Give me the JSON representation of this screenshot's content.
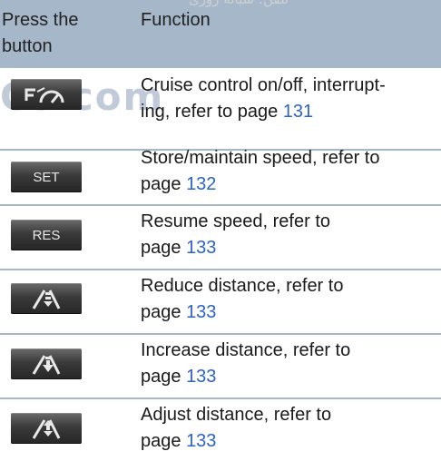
{
  "watermark": {
    "arabic": "تلفن: شبانه روزی",
    "big": "Cs.com"
  },
  "header": {
    "col1": "Press the button",
    "col1_line1": "Press the",
    "col1_line2": "button",
    "col2": "Function"
  },
  "rows": [
    {
      "icon": "cruise-control-icon",
      "button_label": "",
      "line1": "Cruise control on/off, interrupt-",
      "line2_pre": "ing, refer to page ",
      "page": "131"
    },
    {
      "icon": "",
      "button_label": "SET",
      "line1": "Store/maintain speed, refer to",
      "line2_pre": "page ",
      "page": "132"
    },
    {
      "icon": "",
      "button_label": "RES",
      "line1": "Resume speed, refer to",
      "line2_pre": "page ",
      "page": "133"
    },
    {
      "icon": "distance-reduce-icon",
      "button_label": "",
      "line1": "Reduce distance, refer to",
      "line2_pre": "page ",
      "page": "133"
    },
    {
      "icon": "distance-increase-icon",
      "button_label": "",
      "line1": "Increase distance, refer to",
      "line2_pre": "page ",
      "page": "133"
    },
    {
      "icon": "distance-adjust-icon",
      "button_label": "",
      "line1": "Adjust distance, refer to",
      "line2_pre": "page ",
      "page": "133"
    }
  ],
  "colors": {
    "header_bg": "#a7b7ca",
    "link": "#2a64c8",
    "button_bg": "#333333"
  }
}
